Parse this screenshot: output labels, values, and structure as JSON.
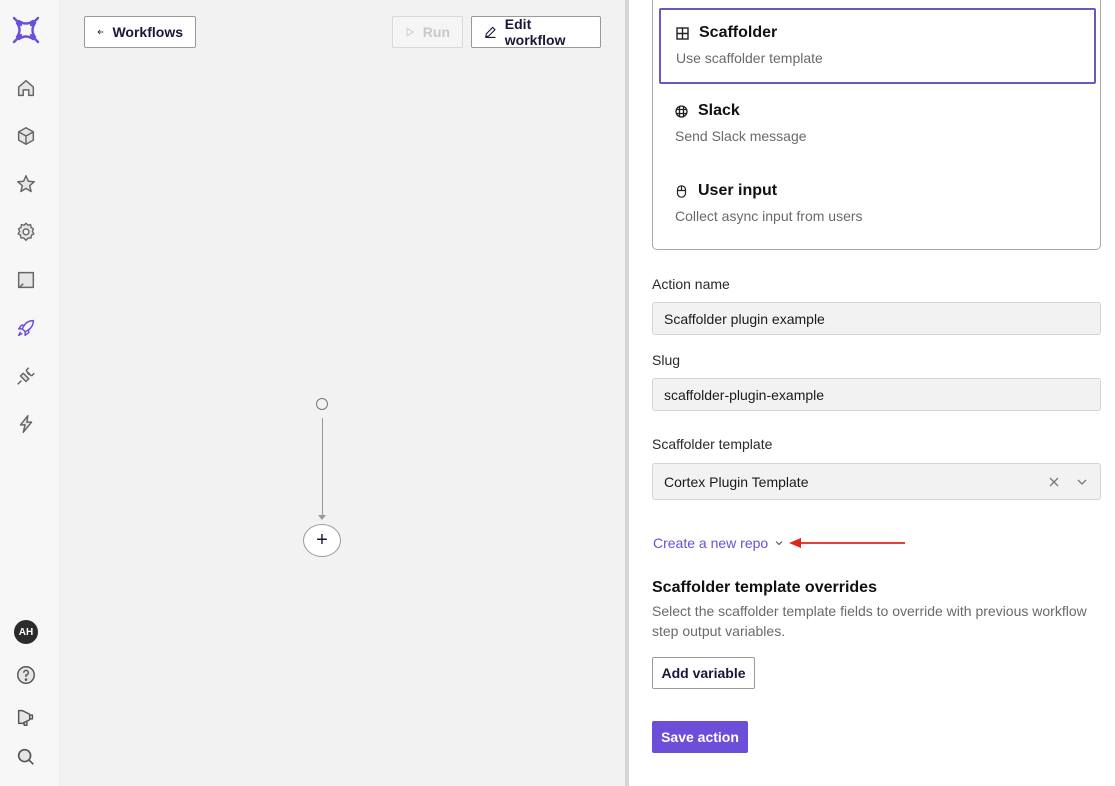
{
  "sidebar": {
    "logo": "cortex-logo",
    "items": [
      {
        "icon": "home-icon",
        "active": false
      },
      {
        "icon": "cube-icon",
        "active": false
      },
      {
        "icon": "star-icon",
        "active": false
      },
      {
        "icon": "gear-icon",
        "active": false
      },
      {
        "icon": "scorecard-icon",
        "active": false
      },
      {
        "icon": "rocket-icon",
        "active": true
      },
      {
        "icon": "plug-icon",
        "active": false
      },
      {
        "icon": "lightning-icon",
        "active": false
      }
    ],
    "avatar_initials": "AH",
    "bottom_items": [
      {
        "icon": "help-icon"
      },
      {
        "icon": "megaphone-icon"
      },
      {
        "icon": "search-icon"
      }
    ],
    "accent_color": "#6b4fd8"
  },
  "toolbar": {
    "back_label": "Workflows",
    "run_label": "Run",
    "run_disabled": true,
    "edit_label": "Edit workflow"
  },
  "canvas": {
    "add_node_label": "+"
  },
  "panel": {
    "action_types": [
      {
        "title": "Scaffolder",
        "description": "Use scaffolder template",
        "icon": "grid-icon",
        "selected": true
      },
      {
        "title": "Slack",
        "description": "Send Slack message",
        "icon": "slack-icon",
        "selected": false
      },
      {
        "title": "User input",
        "description": "Collect async input from users",
        "icon": "mouse-icon",
        "selected": false
      }
    ],
    "action_name": {
      "label": "Action name",
      "value": "Scaffolder plugin example"
    },
    "slug": {
      "label": "Slug",
      "value": "scaffolder-plugin-example"
    },
    "scaffolder_template": {
      "label": "Scaffolder template",
      "value": "Cortex Plugin Template"
    },
    "create_repo_link": "Create a new repo",
    "overrides": {
      "title": "Scaffolder template overrides",
      "description": "Select the scaffolder template fields to override with previous workflow step output variables."
    },
    "add_variable_label": "Add variable",
    "save_label": "Save action",
    "primary_color": "#6b4fd8",
    "annotation_arrow_color": "#e0251b"
  }
}
